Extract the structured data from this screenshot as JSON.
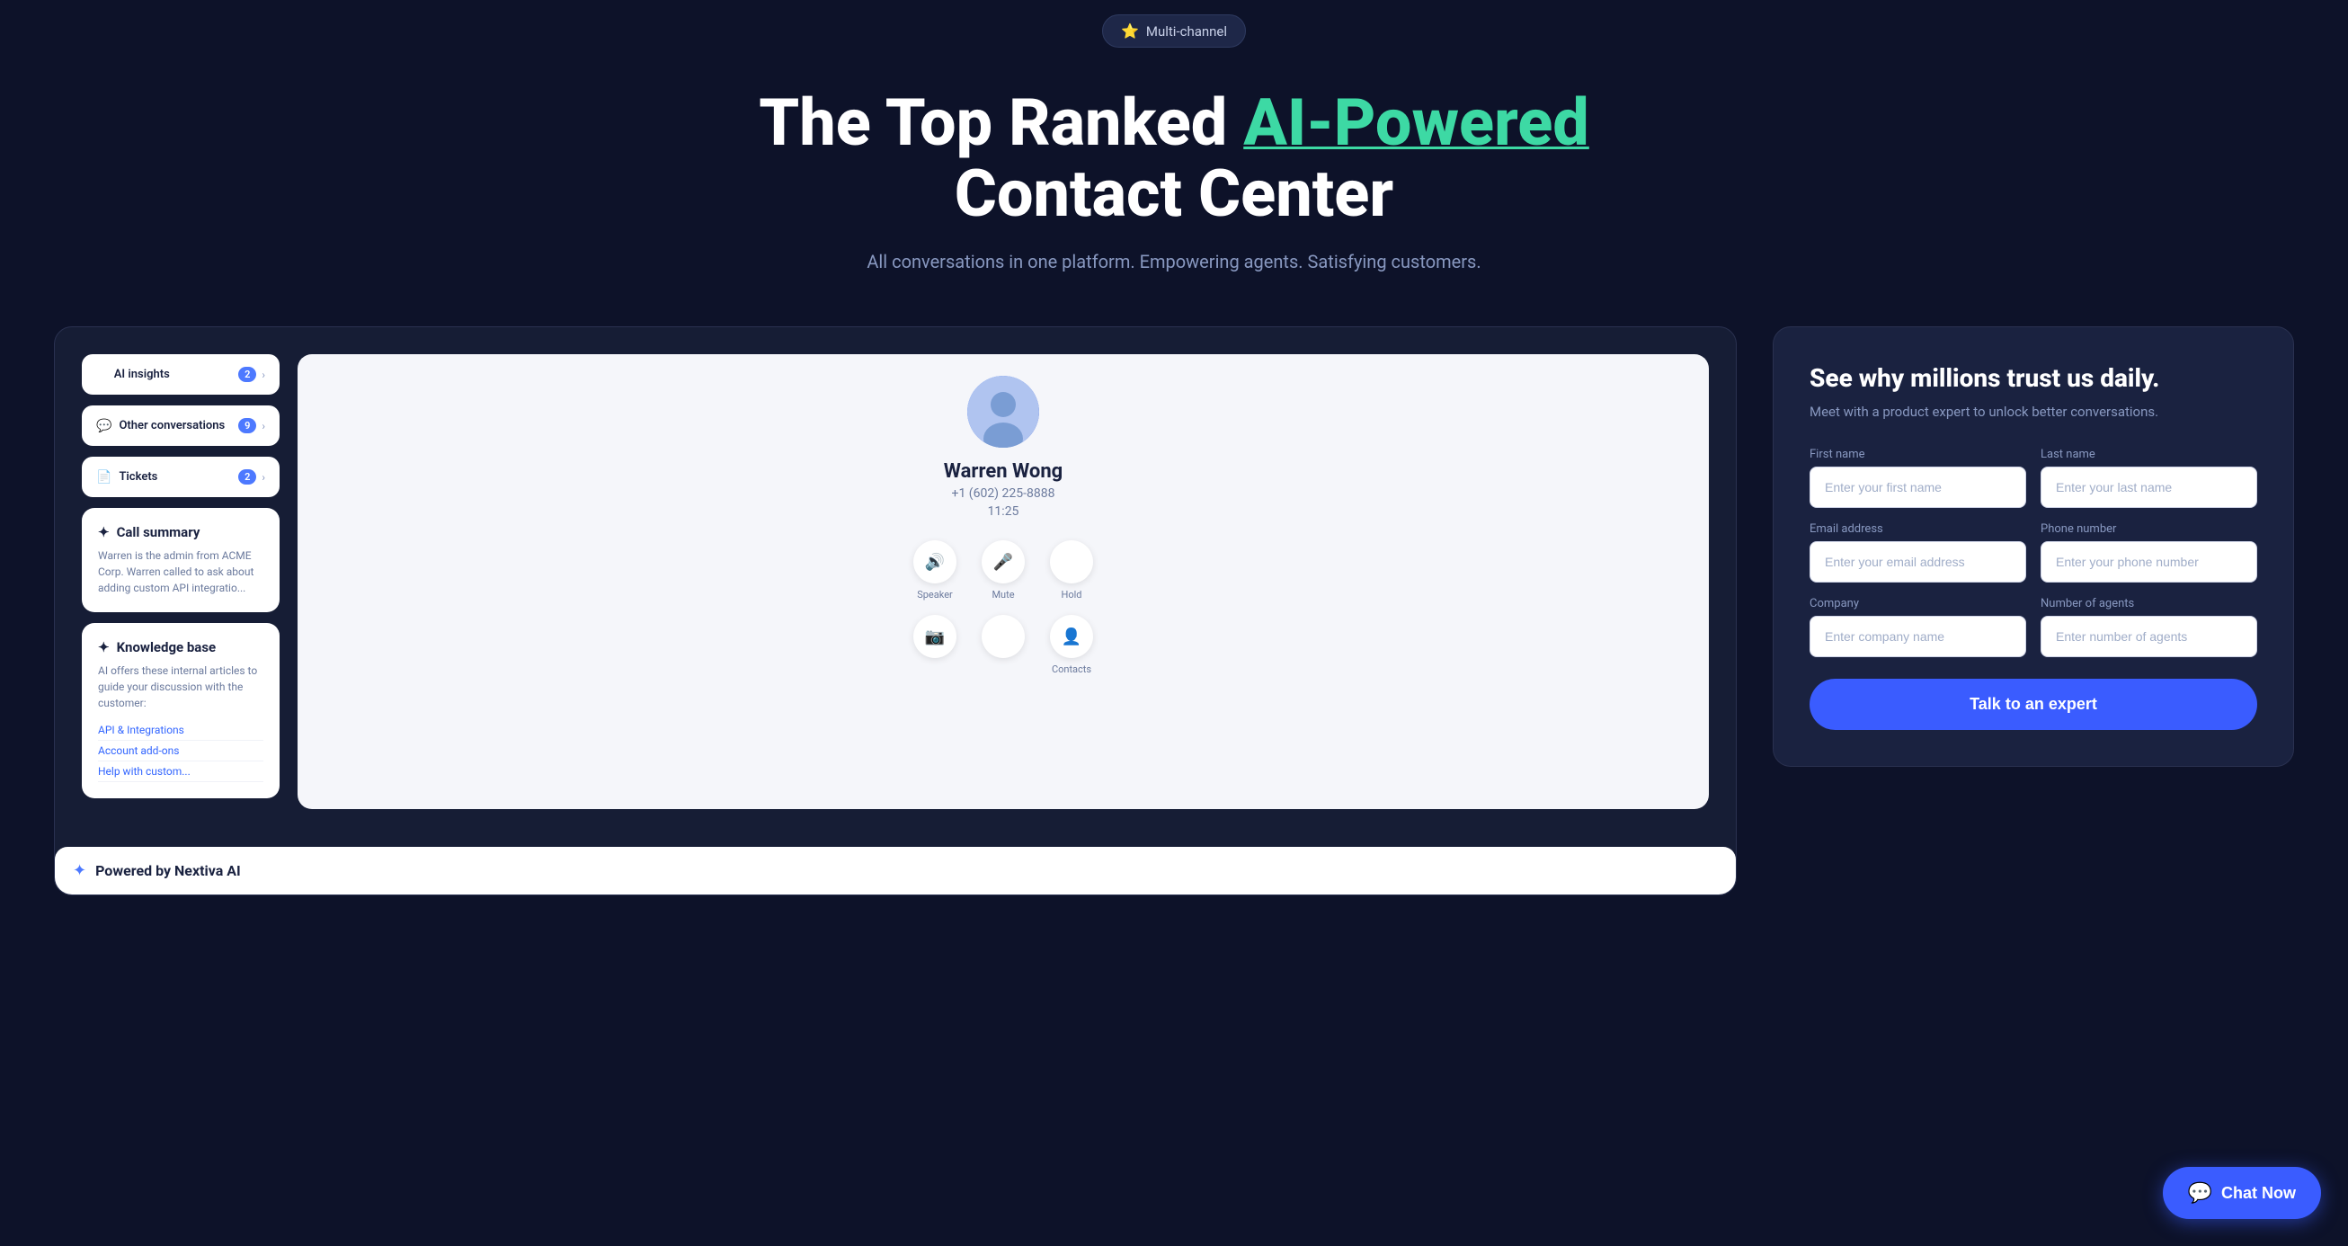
{
  "badge": {
    "icon": "⭐",
    "label": "Multi-channel"
  },
  "hero": {
    "title_part1": "The Top Ranked ",
    "title_accent": "AI-Powered",
    "title_part2": "Contact Center",
    "subtitle": "All conversations in one platform. Empowering agents. Satisfying customers."
  },
  "mockup": {
    "items": [
      {
        "icon": "✦",
        "label": "AI insights",
        "badge": "2",
        "arrow": "›"
      },
      {
        "icon": "💬",
        "label": "Other conversations",
        "badge": "9",
        "arrow": "›"
      },
      {
        "icon": "📄",
        "label": "Tickets",
        "badge": "2",
        "arrow": "›"
      }
    ],
    "call_summary": {
      "title": "Call summary",
      "icon": "✦",
      "text": "Warren is the admin from ACME Corp. Warren called to ask about adding custom API integratio..."
    },
    "knowledge_base": {
      "title": "Knowledge base",
      "icon": "✦",
      "text": "AI offers these internal articles to guide your discussion with the customer:",
      "items": [
        "API & Integrations",
        "Account add-ons",
        "Help with custom..."
      ]
    },
    "caller": {
      "name": "Warren Wong",
      "phone": "+1 (602) 225-8888",
      "time": "11:25"
    },
    "controls": [
      {
        "icon": "🔊",
        "label": "Speaker"
      },
      {
        "icon": "🎤",
        "label": "Mute"
      },
      {
        "icon": "⏸",
        "label": "Hold"
      }
    ],
    "controls2": [
      {
        "icon": "📷",
        "label": ""
      },
      {
        "icon": "⠿",
        "label": ""
      },
      {
        "icon": "👤",
        "label": "Contacts"
      }
    ],
    "powered_by": "Powered by Nextiva AI"
  },
  "form": {
    "heading": "See why millions trust us daily.",
    "subheading": "Meet with a product expert to unlock better conversations.",
    "fields": {
      "first_name": {
        "label": "First name",
        "placeholder": "Enter your first name"
      },
      "last_name": {
        "label": "Last name",
        "placeholder": "Enter your last name"
      },
      "email": {
        "label": "Email address",
        "placeholder": "Enter your email address"
      },
      "phone": {
        "label": "Phone number",
        "placeholder": "Enter your phone number"
      },
      "company": {
        "label": "Company",
        "placeholder": "Enter company name"
      },
      "agents": {
        "label": "Number of agents",
        "placeholder": "Enter number of agents"
      }
    },
    "submit_label": "Talk to an expert"
  },
  "chat_button": {
    "label": "Chat Now",
    "icon": "💬"
  }
}
